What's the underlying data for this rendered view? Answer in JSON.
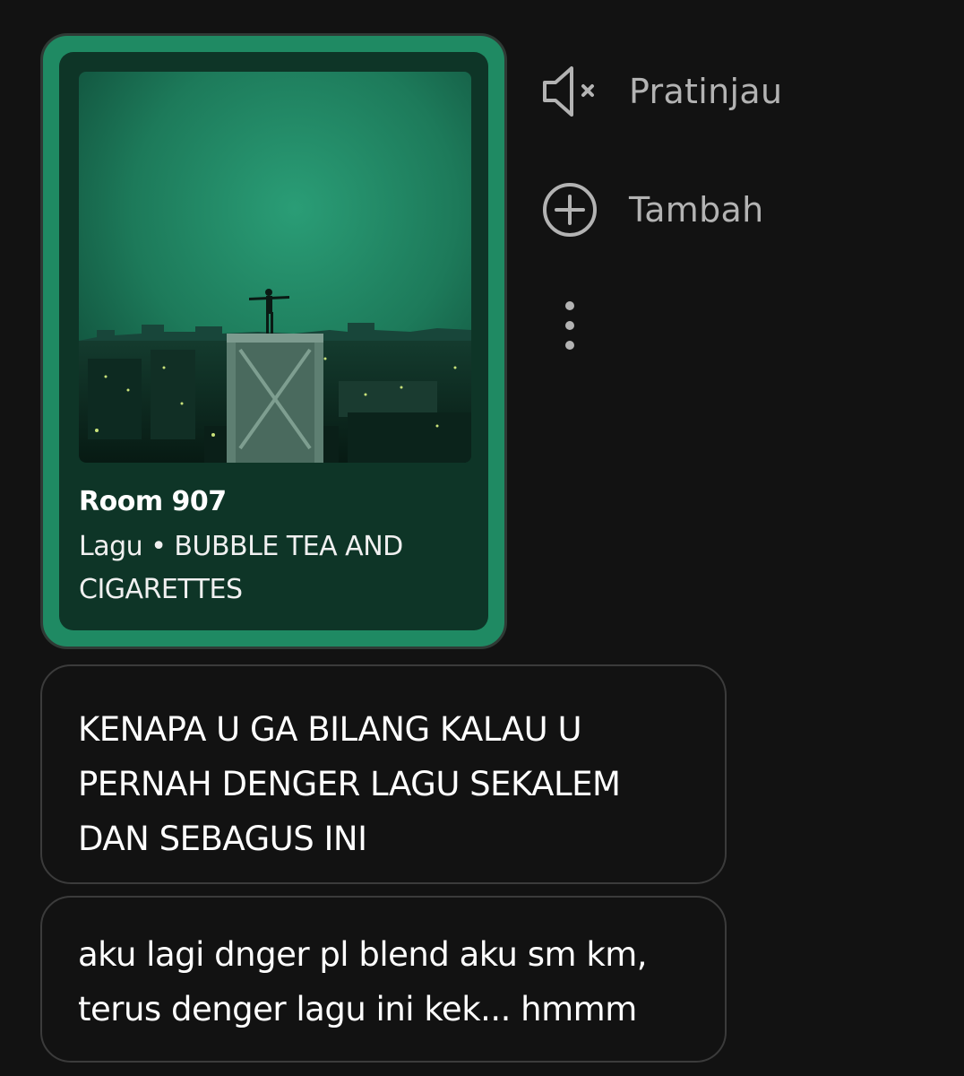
{
  "song_card": {
    "title": "Room 907",
    "subtitle": "Lagu • BUBBLE TEA AND CIGARETTES",
    "accent_color": "#1f8a63",
    "inner_color": "#0e3527",
    "artwork_icon": "album-art-city-rooftop-figure"
  },
  "actions": {
    "preview_label": "Pratinjau",
    "preview_icon": "speaker-muted-icon",
    "add_label": "Tambah",
    "add_icon": "plus-circle-icon",
    "more_icon": "more-vertical-icon"
  },
  "messages": [
    {
      "text": "KENAPA U GA BILANG KALAU U PERNAH DENGER LAGU SEKALEM DAN SEBAGUS INI"
    },
    {
      "text": "aku lagi dnger pl blend aku sm km, terus denger lagu ini kek... hmmm"
    }
  ]
}
